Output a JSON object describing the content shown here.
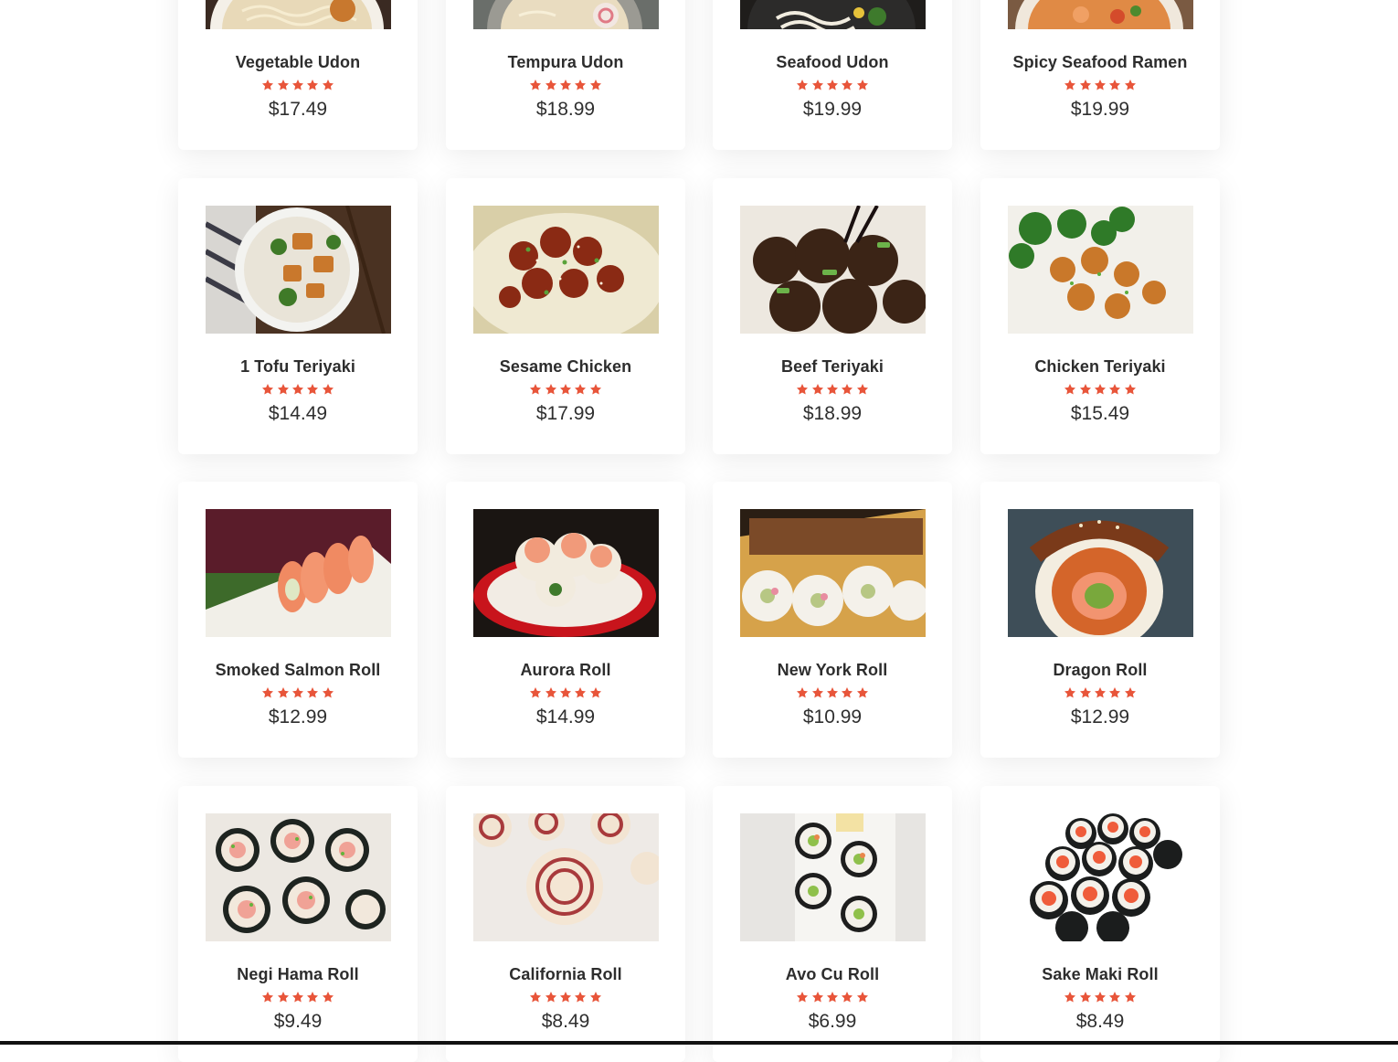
{
  "menu": {
    "rows": [
      [
        {
          "name": "Vegetable Udon",
          "price": "$17.49",
          "rating": 5,
          "image": "vegetable-udon-photo"
        },
        {
          "name": "Tempura Udon",
          "price": "$18.99",
          "rating": 5,
          "image": "tempura-udon-photo"
        },
        {
          "name": "Seafood Udon",
          "price": "$19.99",
          "rating": 5,
          "image": "seafood-udon-photo"
        },
        {
          "name": "Spicy Seafood Ramen",
          "price": "$19.99",
          "rating": 5,
          "image": "spicy-seafood-ramen-photo"
        }
      ],
      [
        {
          "name": "1 Tofu Teriyaki",
          "price": "$14.49",
          "rating": 5,
          "image": "tofu-teriyaki-photo"
        },
        {
          "name": "Sesame Chicken",
          "price": "$17.99",
          "rating": 5,
          "image": "sesame-chicken-photo"
        },
        {
          "name": "Beef Teriyaki",
          "price": "$18.99",
          "rating": 5,
          "image": "beef-teriyaki-photo"
        },
        {
          "name": "Chicken Teriyaki",
          "price": "$15.49",
          "rating": 5,
          "image": "chicken-teriyaki-photo"
        }
      ],
      [
        {
          "name": "Smoked Salmon Roll",
          "price": "$12.99",
          "rating": 5,
          "image": "smoked-salmon-roll-photo"
        },
        {
          "name": "Aurora Roll",
          "price": "$14.99",
          "rating": 5,
          "image": "aurora-roll-photo"
        },
        {
          "name": "New York Roll",
          "price": "$10.99",
          "rating": 5,
          "image": "new-york-roll-photo"
        },
        {
          "name": "Dragon Roll",
          "price": "$12.99",
          "rating": 5,
          "image": "dragon-roll-photo"
        }
      ],
      [
        {
          "name": "Negi Hama Roll",
          "price": "$9.49",
          "rating": 5,
          "image": "negi-hama-roll-photo"
        },
        {
          "name": "California Roll",
          "price": "$8.49",
          "rating": 5,
          "image": "california-roll-photo"
        },
        {
          "name": "Avo Cu Roll",
          "price": "$6.99",
          "rating": 5,
          "image": "avo-cu-roll-photo"
        },
        {
          "name": "Sake Maki Roll",
          "price": "$8.49",
          "rating": 5,
          "image": "sake-maki-roll-photo"
        }
      ]
    ]
  },
  "colors": {
    "star": "#e8553a",
    "text": "#2d2d2d",
    "card_bg": "#ffffff"
  }
}
